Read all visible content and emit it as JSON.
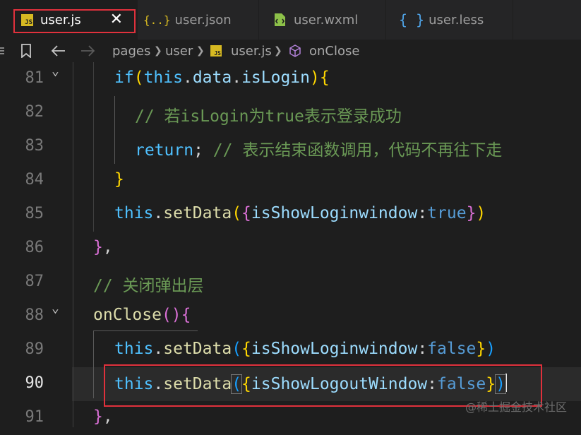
{
  "tabs": [
    {
      "label": "user.js",
      "icon": "js-file-icon",
      "active": true,
      "close": "✕"
    },
    {
      "label": "user.json",
      "icon": "json-file-icon"
    },
    {
      "label": "user.wxml",
      "icon": "wxml-file-icon"
    },
    {
      "label": "user.less",
      "icon": "less-file-icon"
    }
  ],
  "breadcrumb": {
    "items": [
      "pages",
      "user",
      "user.js",
      "onClose"
    ]
  },
  "editor": {
    "current_line": "90",
    "lines": [
      {
        "n": "81",
        "t": [
          "if",
          "(",
          "this",
          ".",
          "data",
          ".",
          "isLogin",
          ")",
          "{"
        ]
      },
      {
        "n": "82",
        "t": [
          "// 若isLogin为true表示登录成功"
        ]
      },
      {
        "n": "83",
        "t": [
          "return",
          "; ",
          "// 表示结束函数调用，代码不再往下走"
        ]
      },
      {
        "n": "84",
        "t": [
          "}"
        ]
      },
      {
        "n": "85",
        "t": [
          "this",
          ".",
          "setData",
          "(",
          "{",
          "isShowLoginwindow",
          ":",
          "true",
          "}",
          ")"
        ]
      },
      {
        "n": "86",
        "t": [
          "}",
          ","
        ]
      },
      {
        "n": "87",
        "t": [
          "// 关闭弹出层"
        ]
      },
      {
        "n": "88",
        "t": [
          "onClose",
          "(",
          ")",
          "{"
        ]
      },
      {
        "n": "89",
        "t": [
          "this",
          ".",
          "setData",
          "(",
          "{",
          "isShowLoginwindow",
          ":",
          "false",
          "}",
          ")"
        ]
      },
      {
        "n": "90",
        "t": [
          "this",
          ".",
          "setData",
          "(",
          "{",
          "isShowLogoutWindow",
          ":",
          "false",
          "}",
          ")"
        ]
      },
      {
        "n": "91",
        "t": [
          "}",
          ","
        ]
      }
    ]
  },
  "watermark": "@稀土掘金技术社区"
}
